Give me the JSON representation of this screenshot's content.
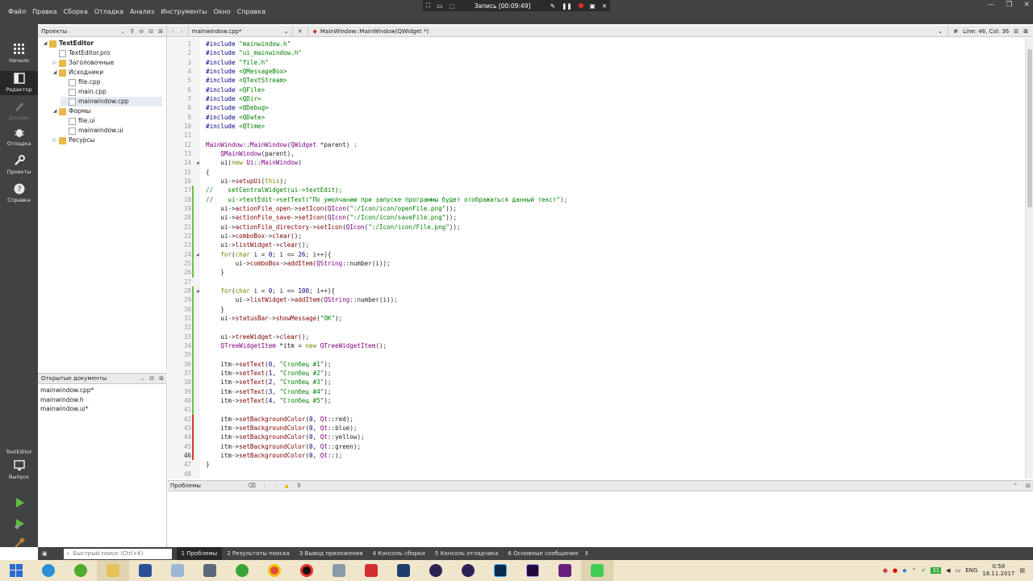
{
  "menu": [
    "Файл",
    "Правка",
    "Сборка",
    "Отладка",
    "Анализ",
    "Инструменты",
    "Окно",
    "Справка"
  ],
  "recording": {
    "label": "Запись [00:09:49]"
  },
  "modes": [
    {
      "label": "Начало",
      "icon": "grid-icon"
    },
    {
      "label": "Редактор",
      "icon": "editor-icon"
    },
    {
      "label": "Дизайн",
      "icon": "design-icon"
    },
    {
      "label": "Отладка",
      "icon": "bug-icon"
    },
    {
      "label": "Проекты",
      "icon": "wrench-icon"
    },
    {
      "label": "Справка",
      "icon": "help-icon"
    }
  ],
  "kit": {
    "project": "TextEditor",
    "build": "Выпуск"
  },
  "projects_panel": {
    "title": "Проекты"
  },
  "tree": [
    {
      "label": "TextEditor",
      "level": 0,
      "type": "project"
    },
    {
      "label": "TextEditor.pro",
      "level": 1,
      "type": "file"
    },
    {
      "label": "Заголовочные",
      "level": 1,
      "type": "folder"
    },
    {
      "label": "Исходники",
      "level": 1,
      "type": "folder"
    },
    {
      "label": "file.cpp",
      "level": 2,
      "type": "file"
    },
    {
      "label": "main.cpp",
      "level": 2,
      "type": "file"
    },
    {
      "label": "mainwindow.cpp",
      "level": 2,
      "type": "file"
    },
    {
      "label": "Формы",
      "level": 1,
      "type": "folder"
    },
    {
      "label": "file.ui",
      "level": 2,
      "type": "file"
    },
    {
      "label": "mainwindow.ui",
      "level": 2,
      "type": "file"
    },
    {
      "label": "Ресурсы",
      "level": 1,
      "type": "folder"
    }
  ],
  "open_docs": {
    "title": "Открытые документы",
    "items": [
      "mainwindow.cpp*",
      "mainwindow.h",
      "mainwindow.ui*"
    ]
  },
  "editor": {
    "file": "mainwindow.cpp*",
    "symbol": "MainWindow::MainWindow(QWidget *)",
    "position": "Line: 46, Col: 36",
    "current_line": 46
  },
  "code_lines": [
    "#include \"mainwindow.h\"",
    "#include \"ui_mainwindow.h\"",
    "#include \"file.h\"",
    "#include <QMessageBox>",
    "#include <QTextStream>",
    "#include <QFile>",
    "#include <QDir>",
    "#include <QDebug>",
    "#include <QDate>",
    "#include <QTime>",
    "",
    "MainWindow::MainWindow(QWidget *parent) :",
    "    QMainWindow(parent),",
    "    ui(new Ui::MainWindow)",
    "{",
    "    ui->setupUi(this);",
    "//    setCentralWidget(ui->textEdit);",
    "//    ui->textEdit->setText(\"По умолчанию при запуске программы будет отображаться данный текст\");",
    "    ui->actionFile_open->setIcon(QIcon(\":/Icon/icon/openFile.png\"));",
    "    ui->actionFile_save->setIcon(QIcon(\":/Icon/icon/saveFile.png\"));",
    "    ui->actionFile_directory->setIcon(QIcon(\":/Icon/icon/File.png\"));",
    "    ui->comboBox->clear();",
    "    ui->listWidget->clear();",
    "    for(char i = 0; i <= 26; i++){",
    "        ui->comboBox->addItem(QString::number(i));",
    "    }",
    "",
    "    for(char i = 0; i <= 100; i++){",
    "        ui->listWidget->addItem(QString::number(i));",
    "    }",
    "    ui->statusBar->showMessage(\"OK\");",
    "",
    "    ui->treeWidget->clear();",
    "    QTreeWidgetItem *itm = new QTreeWidgetItem();",
    "",
    "    itm->setText(0, \"Столбец #1\");",
    "    itm->setText(1, \"Столбец #2\");",
    "    itm->setText(2, \"Столбец #3\");",
    "    itm->setText(3, \"Столбец #4\");",
    "    itm->setText(4, \"Столбец #5\");",
    "",
    "    itm->setBackgroundColor(0, Qt::red);",
    "    itm->setBackgroundColor(0, Qt::blue);",
    "    itm->setBackgroundColor(0, Qt::yellow);",
    "    itm->setBackgroundColor(0, Qt::green);",
    "    itm->setBackgroundColor(0, Qt::);",
    "}",
    ""
  ],
  "problems": {
    "title": "Проблемы"
  },
  "search": {
    "placeholder": "Быстрый поиск (Ctrl+K)"
  },
  "output_tabs": [
    "1  Проблемы",
    "2  Результаты поиска",
    "3  Вывод приложения",
    "4  Консоль сборки",
    "5  Консоль отладчика",
    "6  Основные сообщения"
  ],
  "tray": {
    "lang": "ENG",
    "time": "0:58",
    "date": "18.11.2017",
    "badge": "31"
  },
  "colors": {
    "chrome": "#404244",
    "chrome_active": "#262829",
    "taskbar": "#f0e6cc"
  }
}
